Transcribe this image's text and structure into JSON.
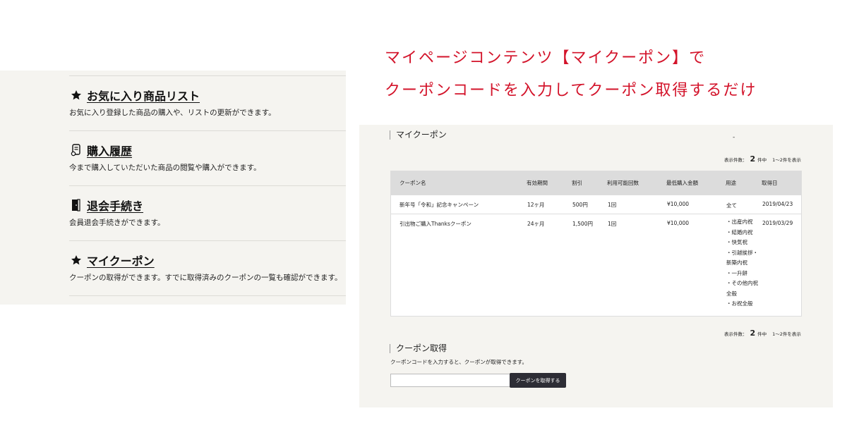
{
  "menu": {
    "items": [
      {
        "icon": "star-icon",
        "title": "お気に入り商品リスト",
        "desc": "お気に入り登録した商品の購入や、リストの更新ができます。"
      },
      {
        "icon": "receipt-icon",
        "title": "購入履歴",
        "desc": "今まで購入していただいた商品の閲覧や購入ができます。"
      },
      {
        "icon": "door-icon",
        "title": "退会手続き",
        "desc": "会員退会手続きができます。"
      },
      {
        "icon": "star-icon",
        "title": "マイクーポン",
        "desc": "クーポンの取得ができます。すでに取得済みのクーポンの一覧も確認ができます。"
      }
    ]
  },
  "caption": {
    "line1": "マイページコンテンツ【マイクーポン】で",
    "line2": "クーポンコードを入力してクーポン取得するだけ"
  },
  "coupons": {
    "title": "マイクーポン",
    "dash": "-",
    "count_label": "表示件数：",
    "count": "2",
    "count_suffix": "件中",
    "range": "1～2件を表示",
    "columns": [
      "クーポン名",
      "有効期間",
      "割引",
      "利用可能回数",
      "最低購入金額",
      "用途",
      "取得日"
    ],
    "rows": [
      {
        "name": "新年号「令和」記念キャンペーン",
        "period": "12ヶ月",
        "discount": "500円",
        "uses": "1回",
        "min": "¥10,000",
        "usage": [
          "全て"
        ],
        "date": "2019/04/23"
      },
      {
        "name": "引出物ご購入Thanksクーポン",
        "period": "24ヶ月",
        "discount": "1,500円",
        "uses": "1回",
        "min": "¥10,000",
        "usage": [
          "・出産内祝",
          "・結婚内祝",
          "・快気祝",
          "・引越挨拶・",
          "新築内祝",
          "・一升餅",
          "・その他内祝",
          "全般",
          "・お祝全般"
        ],
        "date": "2019/03/29"
      }
    ]
  },
  "acquire": {
    "title": "クーポン取得",
    "desc": "クーポンコードを入力すると、クーポンが取得できます。",
    "input_value": "",
    "button_label": "クーポンを取得する"
  },
  "colors": {
    "caption": "#d3132a",
    "panel_bg": "#f5f4f0",
    "button_bg": "#2d2d35"
  }
}
